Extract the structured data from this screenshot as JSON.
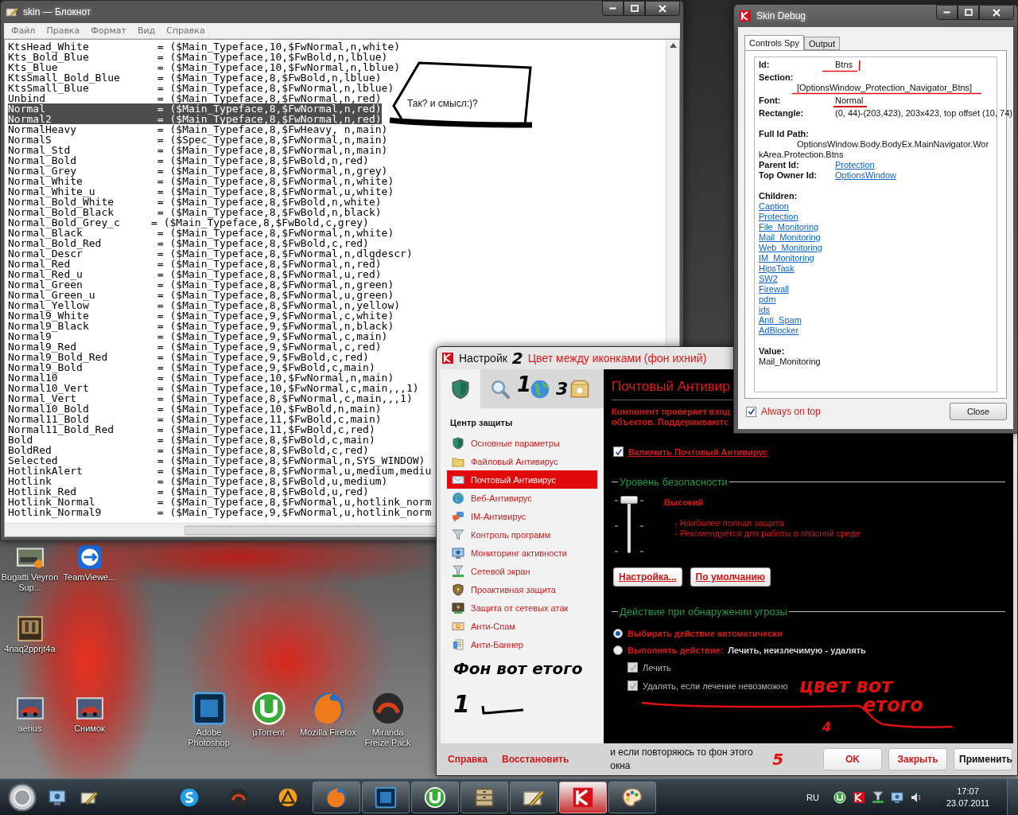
{
  "notepad": {
    "title": "skin — Блокнот",
    "menu": [
      "Файл",
      "Правка",
      "Формат",
      "Вид",
      "Справка"
    ],
    "lines": [
      {
        "text": "KtsHead_White           = ($Main_Typeface,10,$FwNormal,n,white)",
        "selected": false
      },
      {
        "text": "Kts_Bold_Blue           = ($Main_Typeface,10,$FwBold,n,lblue)",
        "selected": false
      },
      {
        "text": "Kts_Blue                = ($Main_Typeface,10,$FwNormal,n,lblue)",
        "selected": false
      },
      {
        "text": "KtsSmall_Bold_Blue      = ($Main_Typeface,8,$FwBold,n,lblue)",
        "selected": false
      },
      {
        "text": "KtsSmall_Blue           = ($Main_Typeface,8,$FwNormal,n,lblue)",
        "selected": false
      },
      {
        "text": "Unbind                  = ($Main_Typeface,8,$FwNormal,n,red)",
        "selected": false
      },
      {
        "text": "Normal                  = ($Main_Typeface,8,$FwNormal,n,red)",
        "selected": true
      },
      {
        "text": "Normal2                 = ($Main_Typeface,8,$FwNormal,n,red)",
        "selected": true
      },
      {
        "text": "NormalHeavy             = ($Main_Typeface,8,$FwHeavy, n,main)",
        "selected": false
      },
      {
        "text": "NormalS                 = ($Spec_Typeface,8,$FwNormal,n,main)",
        "selected": false
      },
      {
        "text": "Normal_Std              = ($Main_Typeface,8,$FwNormal,n,main)",
        "selected": false
      },
      {
        "text": "Normal_Bold             = ($Main_Typeface,8,$FwBold,n,red)",
        "selected": false
      },
      {
        "text": "Normal_Grey             = ($Main_Typeface,8,$FwNormal,n,grey)",
        "selected": false
      },
      {
        "text": "Normal_White            = ($Main_Typeface,8,$FwNormal,n,white)",
        "selected": false
      },
      {
        "text": "Normal_White_u          = ($Main_Typeface,8,$FwNormal,u,white)",
        "selected": false
      },
      {
        "text": "Normal_Bold_White       = ($Main_Typeface,8,$FwBold,n,white)",
        "selected": false
      },
      {
        "text": "Normal_Bold_Black       = ($Main_Typeface,8,$FwBold,n,black)",
        "selected": false
      },
      {
        "text": "Normal_Bold_Grey_c     = ($Main_Typeface,8,$FwBold,c,grey)",
        "selected": false
      },
      {
        "text": "Normal_Black            = ($Main_Typeface,8,$FwNormal,n,white)",
        "selected": false
      },
      {
        "text": "Normal_Bold_Red         = ($Main_Typeface,8,$FwBold,c,red)",
        "selected": false
      },
      {
        "text": "Normal_Descr            = ($Main_Typeface,8,$FwNormal,n,dlgdescr)",
        "selected": false
      },
      {
        "text": "Normal_Red              = ($Main_Typeface,8,$FwNormal,n,red)",
        "selected": false
      },
      {
        "text": "Normal_Red_u            = ($Main_Typeface,8,$FwNormal,u,red)",
        "selected": false
      },
      {
        "text": "Normal_Green            = ($Main_Typeface,8,$FwNormal,n,green)",
        "selected": false
      },
      {
        "text": "Normal_Green_u          = ($Main_Typeface,8,$FwNormal,u,green)",
        "selected": false
      },
      {
        "text": "Normal_Yellow           = ($Main_Typeface,8,$FwNormal,n,yellow)",
        "selected": false
      },
      {
        "text": "Normal9_White           = ($Main_Typeface,9,$FwNormal,c,white)",
        "selected": false
      },
      {
        "text": "Normal9_Black           = ($Main_Typeface,9,$FwNormal,n,black)",
        "selected": false
      },
      {
        "text": "Normal9                 = ($Main_Typeface,9,$FwNormal,c,main)",
        "selected": false
      },
      {
        "text": "Normal9_Red             = ($Main_Typeface,9,$FwNormal,c,red)",
        "selected": false
      },
      {
        "text": "Normal9_Bold_Red        = ($Main_Typeface,9,$FwBold,c,red)",
        "selected": false
      },
      {
        "text": "Normal9_Bold            = ($Main_Typeface,9,$FwBold,c,main)",
        "selected": false
      },
      {
        "text": "Normal10                = ($Main_Typeface,10,$FwNormal,n,main)",
        "selected": false
      },
      {
        "text": "Normal10_Vert           = ($Main_Typeface,10,$FwNormal,c,main,,,1)",
        "selected": false
      },
      {
        "text": "Normal_Vert             = ($Main_Typeface,8,$FwNormal,c,main,,,1)",
        "selected": false
      },
      {
        "text": "Normal10_Bold           = ($Main_Typeface,10,$FwBold,n,main)",
        "selected": false
      },
      {
        "text": "Normal11_Bold           = ($Main_Typeface,11,$FwBold,c,main)",
        "selected": false
      },
      {
        "text": "Normal11_Bold_Red       = ($Main_Typeface,11,$FwBold,c,red)",
        "selected": false
      },
      {
        "text": "Bold                    = ($Main_Typeface,8,$FwBold,c,main)",
        "selected": false
      },
      {
        "text": "BoldRed                 = ($Main_Typeface,8,$FwBold,c,red)",
        "selected": false
      },
      {
        "text": "Selected                = ($Main_Typeface,8,$FwNormal,n,SYS_WINDOW)",
        "selected": false
      },
      {
        "text": "HotlinkAlert            = ($Main_Typeface,8,$FwNormal,u,medium,mediu",
        "selected": false
      },
      {
        "text": "Hotlink                 = ($Main_Typeface,8,$FwBold,u,medium)",
        "selected": false
      },
      {
        "text": "Hotlink_Red             = ($Main_Typeface,8,$FwBold,u,red)",
        "selected": false
      },
      {
        "text": "Hotlink_Normal          = ($Main_Typeface,8,$FwNormal,u,hotlink_norm",
        "selected": false
      },
      {
        "text": "Hotlink_Normal9         = ($Main_Typeface,9,$FwNormal,u,hotlink_norm",
        "selected": false
      }
    ]
  },
  "annotation_box": {
    "text": "Так? и смысл:)?"
  },
  "settings_window": {
    "title": "Настройк",
    "title_note": "Цвет между иконками (фон ихний)",
    "tabs": [
      {
        "kind": "shield",
        "selected": true
      },
      {
        "kind": "search",
        "selected": false
      },
      {
        "kind": "globe",
        "selected": false
      },
      {
        "kind": "box",
        "selected": false
      }
    ],
    "section_title": "Центр защиты",
    "nav": [
      {
        "kind": "shield",
        "label": "Основные параметры",
        "selected": false
      },
      {
        "kind": "folder",
        "label": "Файловый Антивирус",
        "selected": false
      },
      {
        "kind": "mail",
        "label": "Почтовый Антивирус",
        "selected": true
      },
      {
        "kind": "globe",
        "label": "Веб-Антивирус",
        "selected": false
      },
      {
        "kind": "chat",
        "label": "IM-Антивирус",
        "selected": false
      },
      {
        "kind": "funnel",
        "label": "Контроль программ",
        "selected": false
      },
      {
        "kind": "monitor",
        "label": "Мониторинг активности",
        "selected": false
      },
      {
        "kind": "netfunnel",
        "label": "Сетевой экран",
        "selected": false
      },
      {
        "kind": "shieldbolt",
        "label": "Проактивная защита",
        "selected": false
      },
      {
        "kind": "monitorbolt",
        "label": "Защита от сетевых атак",
        "selected": false
      },
      {
        "kind": "spam",
        "label": "Анти-Спам",
        "selected": false
      },
      {
        "kind": "banner",
        "label": "Анти-Баннер",
        "selected": false
      }
    ],
    "heading": "Почтовый Антивир",
    "description": [
      "Компонент проверяет вход",
      "объектов. Поддерживаютс"
    ],
    "enable": {
      "label": "Включить Почтовый Антивирус",
      "checked": true
    },
    "security_group": "Уровень безопасности",
    "slider": {
      "level": 1
    },
    "level_name": "Высокий",
    "level_notes": [
      "- Наиболее полная защита",
      "- Рекомендуется для работы в опасной среде"
    ],
    "buttons": [
      "Настройка...",
      "По умолчанию"
    ],
    "action_group": "Действие при обнаружении угрозы",
    "actions": [
      {
        "label": "Выбирать действие автоматически",
        "selected": true
      },
      {
        "label": "Выполнять действие:",
        "value": "Лечить, неизлечимую - удалять",
        "selected": false
      }
    ],
    "options": [
      {
        "label": "Лечить",
        "checked": true,
        "disabled": true
      },
      {
        "label": "Удалять, если лечение невозможно",
        "checked": true,
        "disabled": true
      }
    ],
    "footer_links": [
      "Справка",
      "Восстановить"
    ],
    "footer_note": "и если повторяюсь то фон этого окна",
    "footer_buttons": [
      "OK",
      "Закрыть",
      "Применить"
    ]
  },
  "debug_window": {
    "title": "Skin Debug",
    "tabs": [
      {
        "label": "Controls Spy",
        "selected": true
      },
      {
        "label": "Output",
        "selected": false
      }
    ],
    "id": {
      "label": "Id:",
      "value": "Btns"
    },
    "section": {
      "label": "Section:",
      "value": "[OptionsWindow_Protection_Navigator_Btns]"
    },
    "font": {
      "label": "Font:",
      "value": "Normal"
    },
    "rectangle": {
      "label": "Rectangle:",
      "value": "(0, 44)-(203,423), 203x423, top offset (10, 74)"
    },
    "full_id": {
      "label": "Full Id Path:",
      "value": "OptionsWindow.Body.BodyEx.MainNavigator.WorkArea.Protection.Btns"
    },
    "links": [
      {
        "label": "Parent Id:",
        "value": "Protection"
      },
      {
        "label": "Top Owner Id:",
        "value": "OptionsWindow"
      }
    ],
    "children_label": "Children:",
    "children": [
      "Caption",
      "Protection",
      "File_Monitoring",
      "Mail_Monitoring",
      "Web_Monitoring",
      "IM_Monitoring",
      "HipsTask",
      "SW2",
      "Firewall",
      "pdm",
      "ids",
      "Anti_Spam",
      "AdBlocker"
    ],
    "value_label": "Value:",
    "value": "Mail_Monitoring",
    "always_on_top": {
      "label": "Always on top",
      "checked": true
    },
    "close": "Close"
  },
  "annotations": [
    {
      "kind": "title_mark",
      "text": "2"
    },
    {
      "kind": "tab_mark",
      "text": "1"
    },
    {
      "kind": "tab_mark_b",
      "text": "3"
    },
    {
      "kind": "sidebar_note",
      "text": "Фон вот етого"
    },
    {
      "kind": "sidebar_mark",
      "text": "1"
    },
    {
      "kind": "content_note",
      "text": "цвет вот етого"
    },
    {
      "kind": "content_mark",
      "text": "4"
    },
    {
      "kind": "footer_mark",
      "text": "5"
    }
  ],
  "desktop_icons": [
    {
      "kind": "thumb",
      "label": "Bugatti Veyron Sup..."
    },
    {
      "kind": "teamviewer",
      "label": "TeamViewe..."
    },
    {
      "kind": "picture",
      "label": "4naq2pprjt4a"
    },
    {
      "kind": "car",
      "label": "aerius"
    },
    {
      "kind": "car",
      "label": "Снимок"
    },
    {
      "kind": "photoshop",
      "label": "Adobe Photoshop"
    },
    {
      "kind": "utorrent",
      "label": "µTorrent"
    },
    {
      "kind": "firefox",
      "label": "Mozilla Firefox"
    },
    {
      "kind": "miranda",
      "label": "Miranda Freize Pack"
    }
  ],
  "taskbar": {
    "quick_launch": [
      {
        "kind": "monitor"
      },
      {
        "kind": "pencil"
      }
    ],
    "pinned": [
      {
        "kind": "skype"
      },
      {
        "kind": "miranda"
      },
      {
        "kind": "aimp"
      }
    ],
    "windows": [
      {
        "kind": "firefox",
        "selected": false
      },
      {
        "kind": "photoshop",
        "selected": false
      },
      {
        "kind": "utorrent",
        "selected": false
      },
      {
        "kind": "archive",
        "selected": false
      },
      {
        "kind": "pencil",
        "selected": false
      },
      {
        "kind": "kaspersky",
        "selected": true
      },
      {
        "kind": "paint",
        "selected": false
      }
    ],
    "language": "RU",
    "time": "17:07",
    "date": "23.07.2011"
  }
}
